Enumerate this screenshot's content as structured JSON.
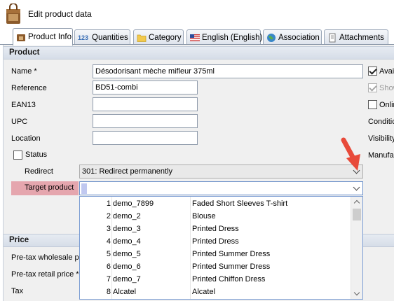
{
  "window": {
    "title": "Edit product data"
  },
  "tabs": [
    {
      "label": "Product Info",
      "icon": "product-icon",
      "active": true
    },
    {
      "label": "Quantities",
      "icon": "quantities-icon",
      "prefix": "123"
    },
    {
      "label": "Category",
      "icon": "folder-icon"
    },
    {
      "label": "English (English)",
      "icon": "us-flag-icon"
    },
    {
      "label": "Association",
      "icon": "globe-icon"
    },
    {
      "label": "Attachments",
      "icon": "attachment-icon"
    }
  ],
  "product": {
    "section_title": "Product",
    "name_label": "Name *",
    "name_value": "Désodorisant mèche mifleur 375ml",
    "reference_label": "Reference",
    "reference_value": "BD51-combi",
    "ean13_label": "EAN13",
    "ean13_value": "",
    "upc_label": "UPC",
    "upc_value": "",
    "location_label": "Location",
    "location_value": "",
    "status_label": "Status",
    "status_checked": false,
    "redirect_label": "Redirect",
    "redirect_value": "301: Redirect permanently",
    "target_label": "Target product",
    "target_value": ""
  },
  "right_column": {
    "available_label": "Avai",
    "available_checked": true,
    "show_label": "Show",
    "show_checked": true,
    "online_label": "Onlin",
    "online_checked": false,
    "condition_label": "Conditio",
    "visibility_label": "Visibility",
    "manufacturer_label": "Manufa"
  },
  "price": {
    "section_title": "Price",
    "wholesale_label": "Pre-tax wholesale pr",
    "retail_label": "Pre-tax retail price *",
    "tax_label": "Tax"
  },
  "dropdown_items": [
    {
      "num": "1",
      "ref": "demo_7899",
      "name": "Faded Short Sleeves T-shirt"
    },
    {
      "num": "2",
      "ref": "demo_2",
      "name": "Blouse"
    },
    {
      "num": "3",
      "ref": "demo_3",
      "name": "Printed Dress"
    },
    {
      "num": "4",
      "ref": "demo_4",
      "name": "Printed Dress"
    },
    {
      "num": "5",
      "ref": "demo_5",
      "name": "Printed Summer Dress"
    },
    {
      "num": "6",
      "ref": "demo_6",
      "name": "Printed Summer Dress"
    },
    {
      "num": "7",
      "ref": "demo_7",
      "name": "Printed Chiffon Dress"
    },
    {
      "num": "8",
      "ref": "Alcatel",
      "name": "Alcatel"
    }
  ],
  "colors": {
    "target_highlight": "#e5a6ae",
    "arrow": "#e84a3a",
    "section_header": "#d6dde8"
  }
}
